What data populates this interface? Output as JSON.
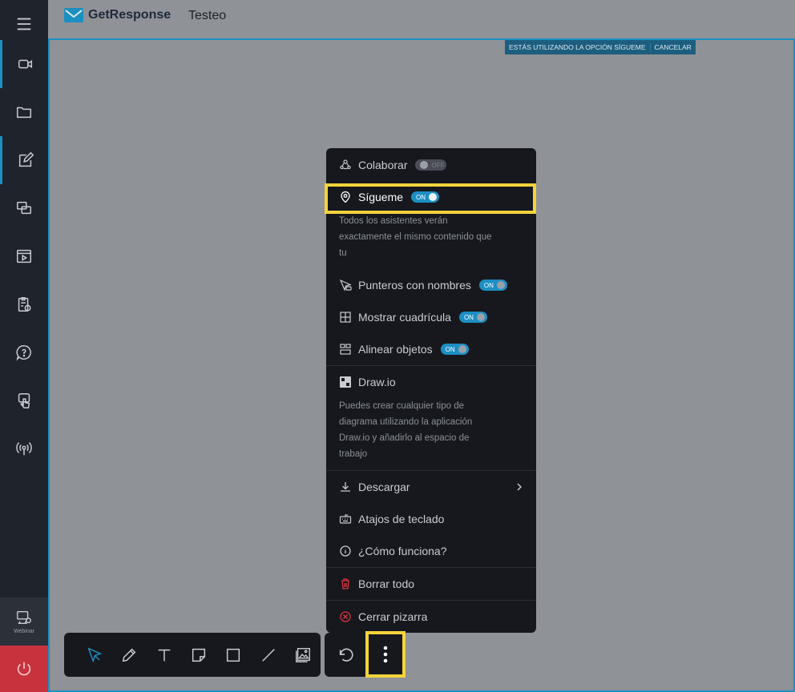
{
  "header": {
    "logo_text": "GetResponse",
    "title": "Testeo"
  },
  "banner": {
    "text": "ESTÁS UTILIZANDO LA OPCIÓN SÍGUEME",
    "cancel": "CANCELAR"
  },
  "sidebar": {
    "items": [
      {
        "name": "video-icon"
      },
      {
        "name": "folder-icon"
      },
      {
        "name": "edit-icon"
      },
      {
        "name": "screen-share-icon"
      },
      {
        "name": "media-icon"
      },
      {
        "name": "clipboard-icon"
      },
      {
        "name": "help-icon"
      },
      {
        "name": "touch-icon"
      },
      {
        "name": "broadcast-icon"
      }
    ],
    "webinar_label": "Webinar"
  },
  "menu": {
    "colaborar": {
      "label": "Colaborar",
      "toggle": "OFF"
    },
    "sigueme": {
      "label": "Sígueme",
      "toggle": "ON",
      "description": "Todos los asistentes verán exactamente el mismo contenido que tu"
    },
    "punteros": {
      "label": "Punteros con nombres",
      "toggle": "ON"
    },
    "cuadricula": {
      "label": "Mostrar cuadrícula",
      "toggle": "ON"
    },
    "alinear": {
      "label": "Alinear objetos",
      "toggle": "ON"
    },
    "drawio": {
      "label": "Draw.io",
      "description": "Puedes crear cualquier tipo de diagrama utilizando la aplicación Draw.io y añadirlo al espacio de trabajo"
    },
    "descargar": {
      "label": "Descargar"
    },
    "atajos": {
      "label": "Atajos de teclado"
    },
    "como": {
      "label": "¿Cómo funciona?"
    },
    "borrar": {
      "label": "Borrar todo"
    },
    "cerrar": {
      "label": "Cerrar pizarra"
    }
  },
  "colors": {
    "accent": "#1c8fc2",
    "highlight": "#f5d33b",
    "danger": "#e0333f"
  }
}
